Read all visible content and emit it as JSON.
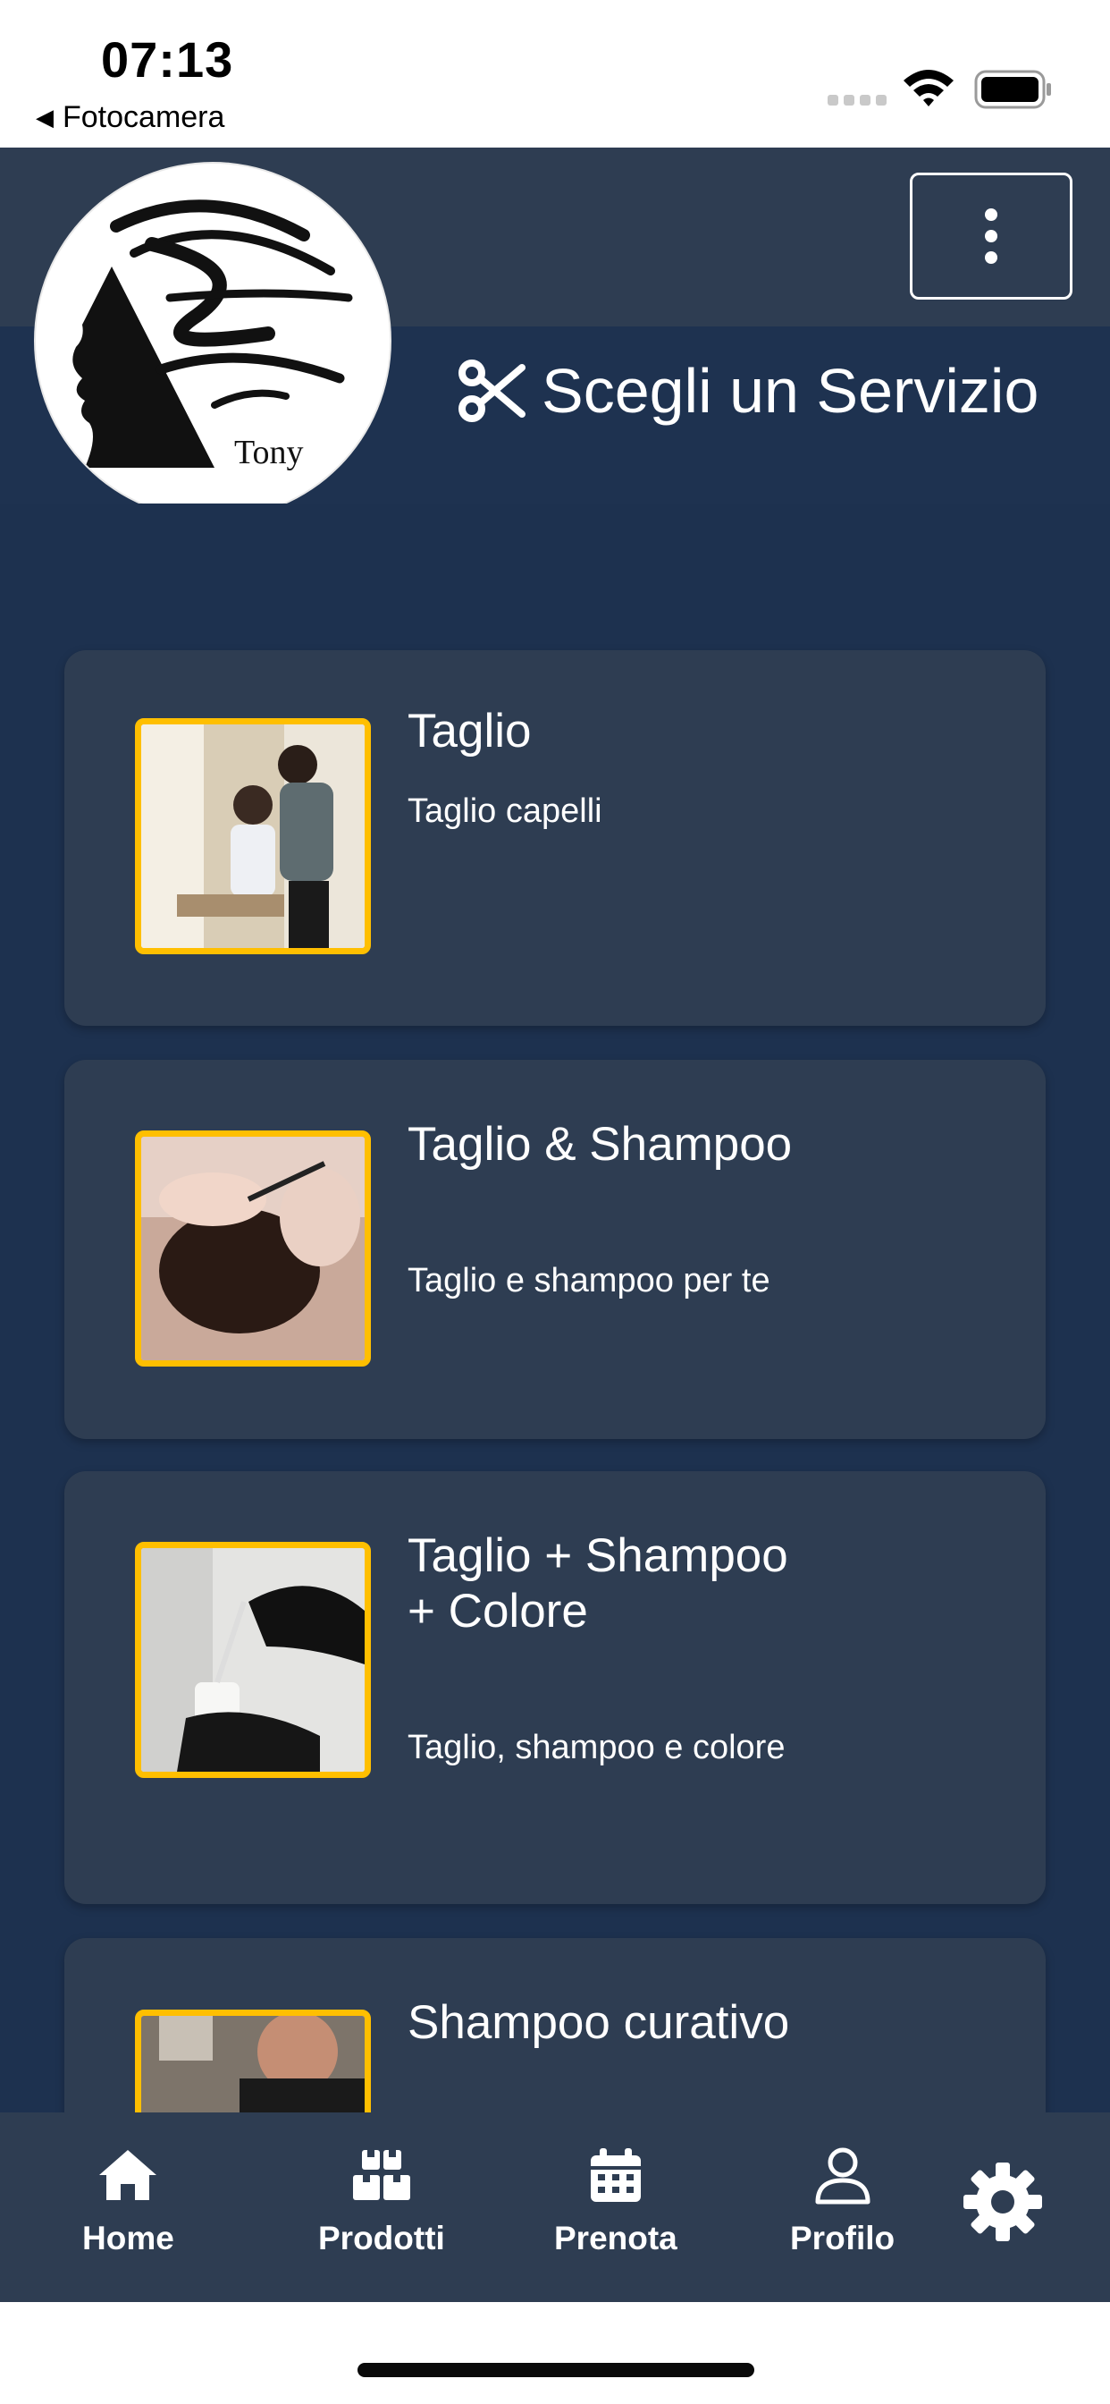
{
  "status_bar": {
    "time": "07:13",
    "back_label": "Fotocamera",
    "icons": [
      "signal-icon",
      "wifi-icon",
      "battery-icon"
    ]
  },
  "header": {
    "logo_text": "Tony",
    "title": "Scegli un Servizio",
    "title_icon": "scissors-icon",
    "menu_icon": "kebab-menu-icon"
  },
  "services": [
    {
      "title": "Taglio",
      "description": "Taglio capelli"
    },
    {
      "title": "Taglio & Shampoo",
      "description": "Taglio e shampoo per te"
    },
    {
      "title": "Taglio + Shampoo + Colore",
      "description": "Taglio, shampoo e colore"
    },
    {
      "title": "Shampoo curativo",
      "description": ""
    }
  ],
  "bottom_nav": [
    {
      "label": "Home",
      "icon": "home-icon"
    },
    {
      "label": "Prodotti",
      "icon": "boxes-icon"
    },
    {
      "label": "Prenota",
      "icon": "calendar-icon"
    },
    {
      "label": "Profilo",
      "icon": "user-icon"
    }
  ],
  "floating_action_icon": "gear-icon",
  "colors": {
    "header": "#2e3d52",
    "band": "#1e3250",
    "background": "#1d314f",
    "card": "#2e3d52",
    "accent": "#ffbf00",
    "text": "#ffffff"
  }
}
